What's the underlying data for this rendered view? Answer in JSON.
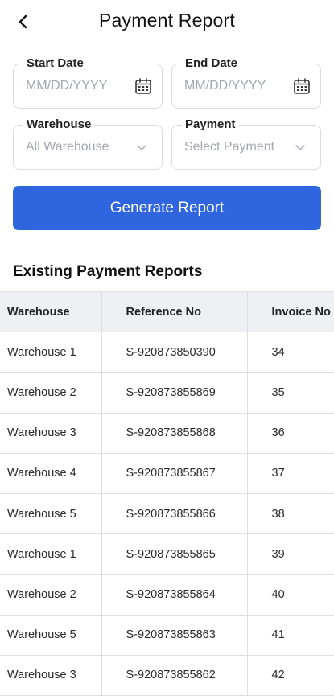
{
  "header": {
    "title": "Payment Report"
  },
  "filters": {
    "start_date": {
      "label": "Start Date",
      "placeholder": "MM/DD/YYYY"
    },
    "end_date": {
      "label": "End Date",
      "placeholder": "MM/DD/YYYY"
    },
    "warehouse": {
      "label": "Warehouse",
      "value": "All Warehouse"
    },
    "payment": {
      "label": "Payment",
      "value": "Select Payment"
    }
  },
  "generate_button": {
    "label": "Generate Report"
  },
  "reports": {
    "title": "Existing Payment Reports",
    "columns": [
      "Warehouse",
      "Reference No",
      "Invoice No"
    ],
    "rows": [
      {
        "warehouse": "Warehouse 1",
        "reference": "S-920873850390",
        "invoice": "34"
      },
      {
        "warehouse": "Warehouse 2",
        "reference": "S-920873855869",
        "invoice": "35"
      },
      {
        "warehouse": "Warehouse 3",
        "reference": "S-920873855868",
        "invoice": "36"
      },
      {
        "warehouse": "Warehouse 4",
        "reference": "S-920873855867",
        "invoice": "37"
      },
      {
        "warehouse": "Warehouse 5",
        "reference": "S-920873855866",
        "invoice": "38"
      },
      {
        "warehouse": "Warehouse 1",
        "reference": "S-920873855865",
        "invoice": "39"
      },
      {
        "warehouse": "Warehouse 2",
        "reference": "S-920873855864",
        "invoice": "40"
      },
      {
        "warehouse": "Warehouse 5",
        "reference": "S-920873855863",
        "invoice": "41"
      },
      {
        "warehouse": "Warehouse 3",
        "reference": "S-920873855862",
        "invoice": "42"
      }
    ]
  },
  "colors": {
    "primary": "#2f66e0",
    "header_bg": "#eef0f3",
    "border": "#dcdfe4",
    "placeholder": "#a3a8b0"
  },
  "icons": {
    "back": "chevron-left-icon",
    "date": "calendar-icon",
    "dropdown": "chevron-down-icon"
  }
}
